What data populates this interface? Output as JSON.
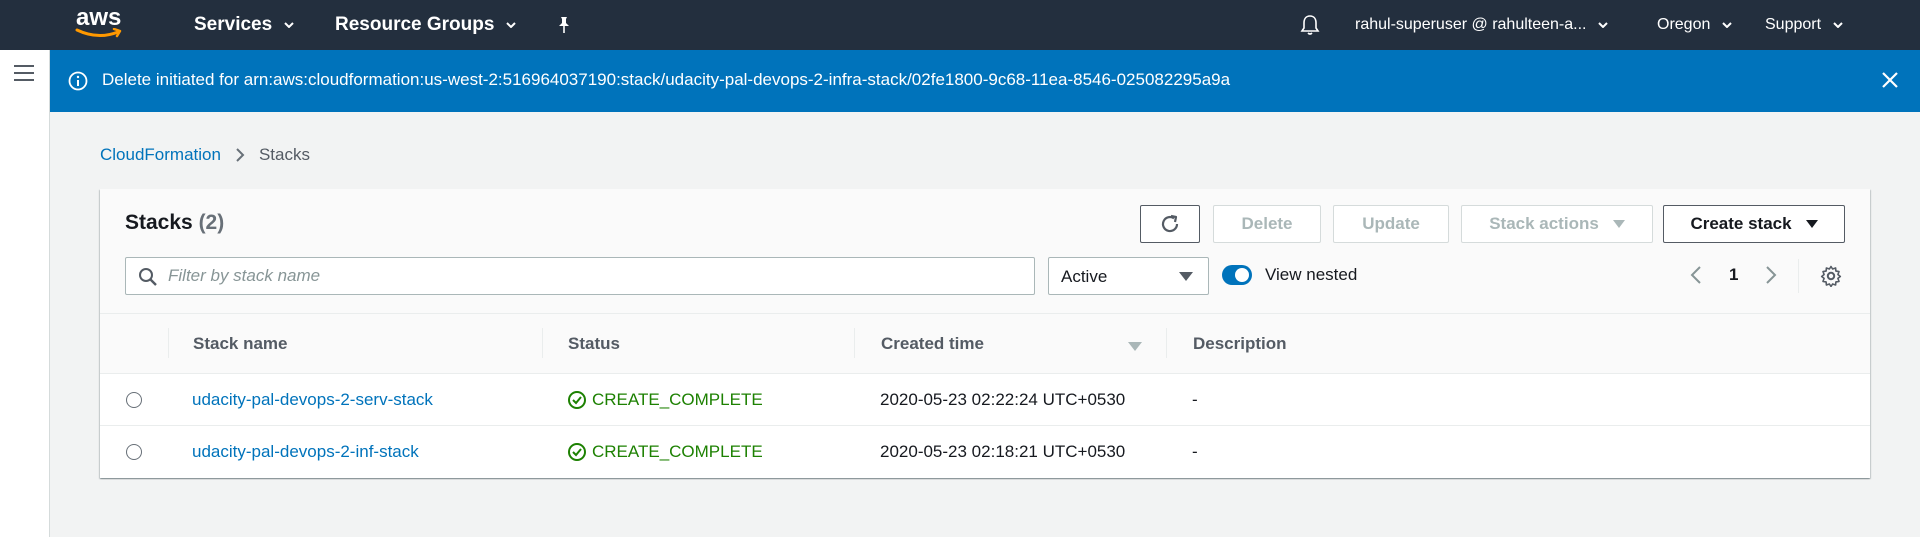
{
  "colors": {
    "nav_bg": "#232f3e",
    "flash_bg": "#0073bb",
    "link": "#0073bb",
    "success": "#1d8102",
    "page_bg": "#f2f3f3"
  },
  "topnav": {
    "logo_text": "aws",
    "services_label": "Services",
    "resource_groups_label": "Resource Groups",
    "pin_icon": "pushpin-icon",
    "bell_icon": "bell-icon",
    "account_label": "rahul-superuser @ rahulteen-a...",
    "region_label": "Oregon",
    "support_label": "Support"
  },
  "flash": {
    "icon": "info-icon",
    "message": "Delete initiated for arn:aws:cloudformation:us-west-2:516964037190:stack/udacity-pal-devops-2-infra-stack/02fe1800-9c68-11ea-8546-025082295a9a",
    "close_icon": "close-icon"
  },
  "breadcrumb": {
    "root": "CloudFormation",
    "current": "Stacks"
  },
  "stacks_panel": {
    "title": "Stacks",
    "count": "(2)",
    "buttons": {
      "refresh_icon": "refresh-icon",
      "delete": "Delete",
      "update": "Update",
      "stack_actions": "Stack actions",
      "create_stack": "Create stack"
    },
    "search_placeholder": "Filter by stack name",
    "status_filter": "Active",
    "view_nested_label": "View nested",
    "view_nested_on": true,
    "page_number": "1"
  },
  "table": {
    "columns": [
      "Stack name",
      "Status",
      "Created time",
      "Description"
    ],
    "sorted_column": "Created time",
    "rows": [
      {
        "name": "udacity-pal-devops-2-serv-stack",
        "status": "CREATE_COMPLETE",
        "created": "2020-05-23 02:22:24 UTC+0530",
        "description": "-"
      },
      {
        "name": "udacity-pal-devops-2-inf-stack",
        "status": "CREATE_COMPLETE",
        "created": "2020-05-23 02:18:21 UTC+0530",
        "description": "-"
      }
    ]
  }
}
